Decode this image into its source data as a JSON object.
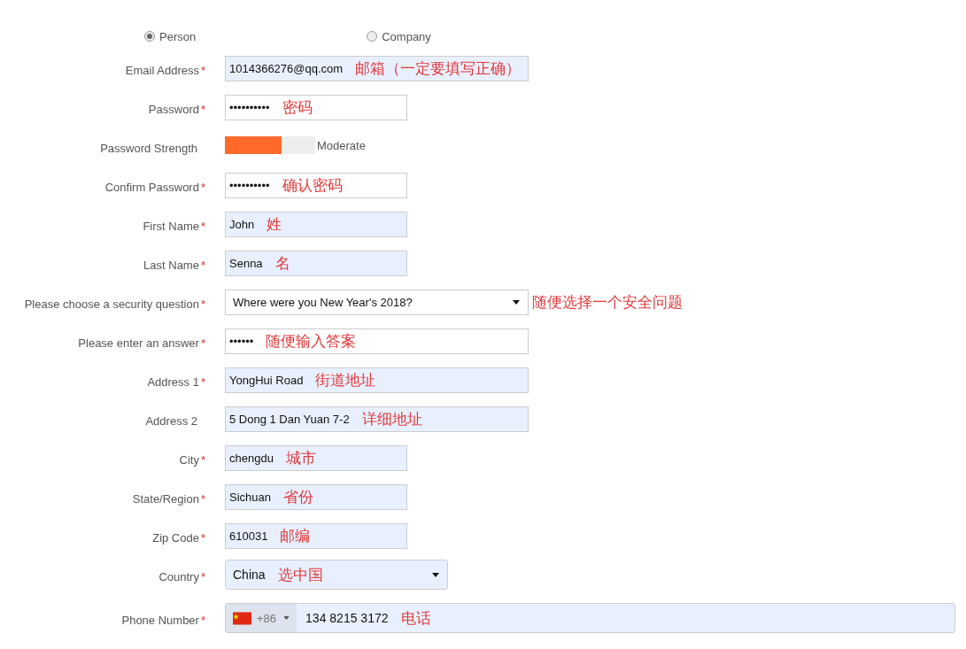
{
  "account_type": [
    {
      "label": "Person",
      "selected": true
    },
    {
      "label": "Company",
      "selected": false
    }
  ],
  "fields": [
    {
      "kind": "text",
      "label": "Email Address",
      "marker": "*",
      "value": "1014366276@qq.com",
      "autofilled": true,
      "wide": true,
      "annotation": "邮箱（一定要填写正确）"
    },
    {
      "kind": "password",
      "label": "Password",
      "marker": "*",
      "value": "••••••••••",
      "autofilled": false,
      "wide": false,
      "annotation": "密码"
    },
    {
      "kind": "strength",
      "label": "Password Strength",
      "level": 0.63,
      "reading": "Moderate"
    },
    {
      "kind": "password",
      "label": "Confirm Password",
      "marker": "*",
      "value": "••••••••••",
      "autofilled": false,
      "wide": false,
      "annotation": "确认密码"
    },
    {
      "kind": "text",
      "label": "First Name",
      "marker": "*",
      "value": "John",
      "autofilled": true,
      "wide": false,
      "annotation": "姓"
    },
    {
      "kind": "text",
      "label": "Last Name",
      "marker": "*",
      "value": "Senna",
      "autofilled": true,
      "wide": false,
      "annotation": "名"
    },
    {
      "kind": "select",
      "label": "Please choose a security question",
      "marker": "*",
      "value": "Where were you New Year's 2018?",
      "autofilled": false,
      "wide": true,
      "annotation": "随便选择一个安全问题"
    },
    {
      "kind": "password",
      "label": "Please enter an answer",
      "marker": "*",
      "value": "••••••",
      "autofilled": false,
      "wide": true,
      "annotation": "随便输入答案"
    },
    {
      "kind": "text",
      "label": "Address 1",
      "marker": "*",
      "value": "YongHui Road",
      "autofilled": true,
      "wide": true,
      "annotation": "街道地址"
    },
    {
      "kind": "text",
      "label": "Address 2",
      "value": "5 Dong 1 Dan Yuan 7-2",
      "autofilled": true,
      "wide": true,
      "annotation": "详细地址"
    },
    {
      "kind": "text",
      "label": "City",
      "marker": "*",
      "value": "chengdu",
      "autofilled": true,
      "wide": false,
      "annotation": "城市"
    },
    {
      "kind": "text",
      "label": "State/Region",
      "marker": "*",
      "value": "Sichuan",
      "autofilled": true,
      "wide": false,
      "annotation": "省份"
    },
    {
      "kind": "text",
      "label": "Zip Code",
      "marker": "*",
      "value": "610031",
      "autofilled": true,
      "wide": false,
      "annotation": "邮编"
    },
    {
      "kind": "select",
      "label": "Country",
      "marker": "*",
      "value": "China",
      "autofilled": true,
      "wide": false,
      "annotation": "选中国"
    },
    {
      "kind": "phone",
      "label": "Phone Number",
      "marker": "*",
      "dial_code": "+86",
      "value": "134 8215 3172",
      "autofilled": true,
      "annotation": "电话"
    }
  ]
}
